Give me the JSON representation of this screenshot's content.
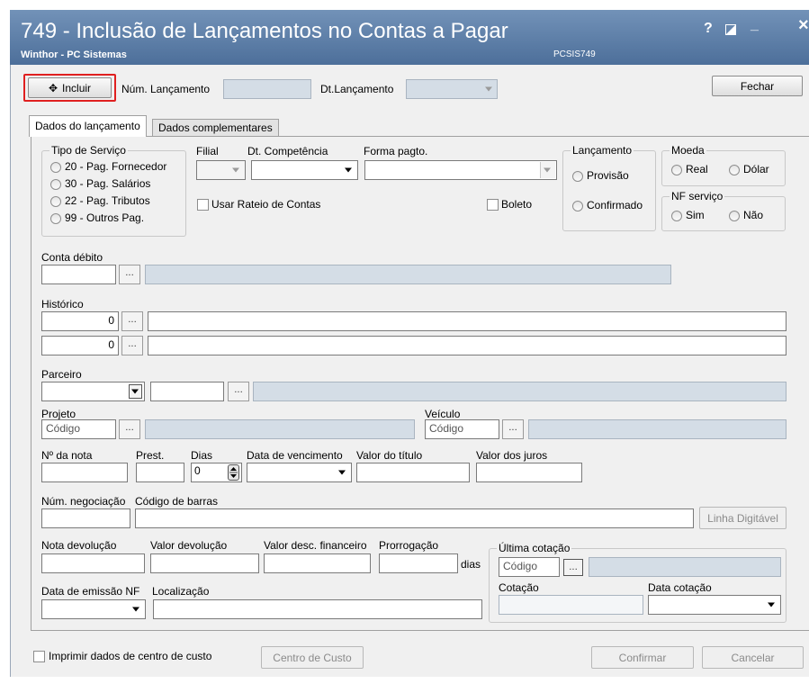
{
  "window": {
    "title": "749 - Inclusão de Lançamentos no Contas a Pagar",
    "subtitle": "Winthor - PC Sistemas",
    "routine_code": "PCSIS749",
    "help_label": "?",
    "minimize_label": "_",
    "close_label": "×"
  },
  "toolbar": {
    "incluir_icon": "✥",
    "incluir_label": "Incluir",
    "num_lancamento_label": "Núm. Lançamento",
    "dt_lancamento_label": "Dt.Lançamento",
    "fechar_label": "Fechar"
  },
  "tabs": [
    {
      "label": "Dados do lançamento",
      "active": true
    },
    {
      "label": "Dados complementares",
      "active": false
    }
  ],
  "tipo_servico": {
    "title": "Tipo de Serviço",
    "options": [
      "20 - Pag. Fornecedor",
      "30 - Pag. Salários",
      "22 - Pag. Tributos",
      "99 - Outros Pag."
    ]
  },
  "filial_label": "Filial",
  "dt_competencia_label": "Dt. Competência",
  "forma_pagto_label": "Forma pagto.",
  "usar_rateio_label": "Usar Rateio de Contas",
  "boleto_label": "Boleto",
  "lancamento": {
    "title": "Lançamento",
    "options": [
      "Provisão",
      "Confirmado"
    ]
  },
  "moeda": {
    "title": "Moeda",
    "options": [
      "Real",
      "Dólar"
    ]
  },
  "nf_servico": {
    "title": "NF serviço",
    "options": [
      "Sim",
      "Não"
    ]
  },
  "conta_debito_label": "Conta débito",
  "ellipsis": "...",
  "historico": {
    "label": "Histórico",
    "values": [
      "0",
      "0"
    ]
  },
  "parceiro_label": "Parceiro",
  "projeto": {
    "label": "Projeto",
    "placeholder": "Código"
  },
  "veiculo": {
    "label": "Veículo",
    "placeholder": "Código"
  },
  "row_nota": {
    "num_nota_label": "Nº da nota",
    "prest_label": "Prest.",
    "dias_label": "Dias",
    "dias_value": "0",
    "data_vencimento_label": "Data de vencimento",
    "valor_titulo_label": "Valor do título",
    "valor_juros_label": "Valor dos juros"
  },
  "num_negociacao_label": "Núm. negociação",
  "codigo_barras_label": "Código de barras",
  "linha_digitavel_label": "Linha Digitável",
  "devolucao": {
    "nota_devolucao_label": "Nota devolução",
    "valor_devolucao_label": "Valor devolução",
    "valor_desc_financeiro_label": "Valor desc. financeiro",
    "prorrogacao_label": "Prorrogação",
    "dias_suffix": "dias"
  },
  "ultima_cotacao": {
    "title": "Última cotação",
    "codigo_placeholder": "Código",
    "cotacao_label": "Cotação",
    "data_cotacao_label": "Data cotação"
  },
  "data_emissao_nf_label": "Data de emissão NF",
  "localizacao_label": "Localização",
  "footer": {
    "imprimir_label": "Imprimir dados de centro de custo",
    "centro_custo_label": "Centro de Custo",
    "confirmar_label": "Confirmar",
    "cancelar_label": "Cancelar"
  },
  "colors": {
    "titlebar": "#5a7ca8",
    "highlight": "#e02020",
    "readonly_field": "#d4dde6"
  }
}
